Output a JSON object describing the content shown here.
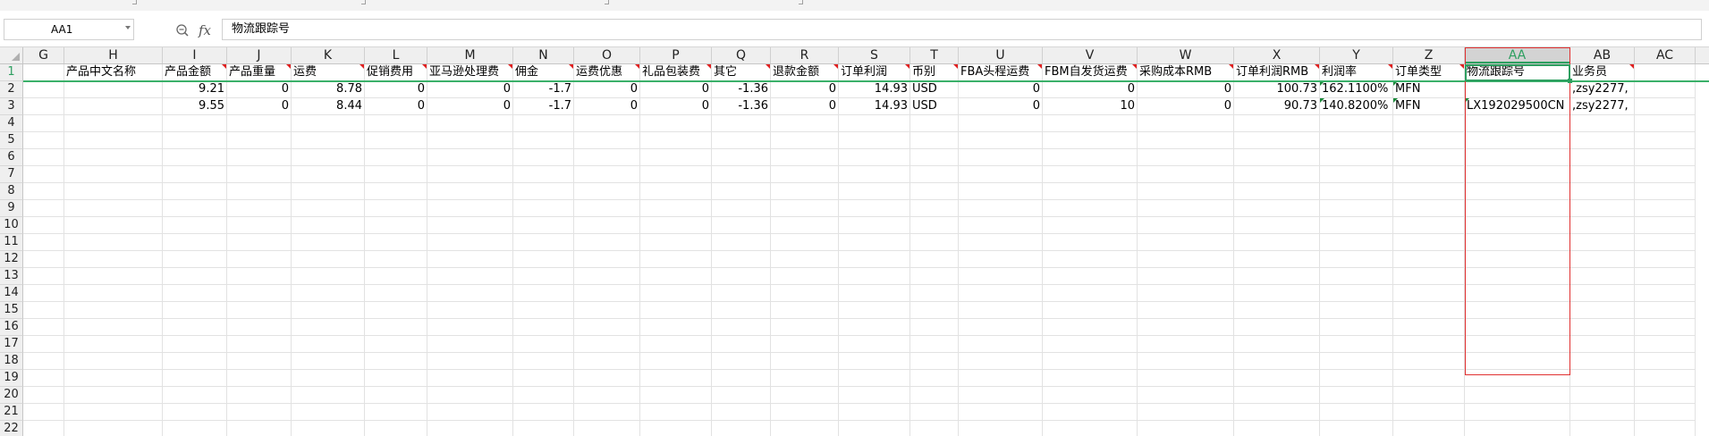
{
  "formula_bar": {
    "name_box": "AA1",
    "zoom_icon": "zoom-icon",
    "fx_label": "fx",
    "formula_value": "物流跟踪号"
  },
  "columns": [
    "G",
    "H",
    "I",
    "J",
    "K",
    "L",
    "M",
    "N",
    "O",
    "P",
    "Q",
    "R",
    "S",
    "T",
    "U",
    "V",
    "W",
    "X",
    "Y",
    "Z",
    "AA",
    "AB",
    "AC"
  ],
  "selected_column": "AA",
  "rows": [
    "1",
    "2",
    "3",
    "4",
    "5",
    "6",
    "7",
    "8",
    "9",
    "10",
    "11",
    "12",
    "13",
    "14",
    "15",
    "16",
    "17",
    "18",
    "19",
    "20",
    "21",
    "22"
  ],
  "selected_row": "1",
  "header_row": [
    "",
    "产品中文名称",
    "产品金额",
    "产品重量",
    "运费",
    "促销费用",
    "亚马逊处理费",
    "佣金",
    "运费优惠",
    "礼品包装费",
    "其它",
    "退款金额",
    "订单利润",
    "币别",
    "FBA头程运费",
    "FBM自发货运费",
    "采购成本RMB",
    "订单利润RMB",
    "利润率",
    "订单类型",
    "物流跟踪号",
    "业务员",
    ""
  ],
  "data_rows": [
    [
      "",
      "",
      "9.21",
      "0",
      "8.78",
      "0",
      "0",
      "-1.7",
      "0",
      "0",
      "-1.36",
      "0",
      "14.93",
      "USD",
      "0",
      "0",
      "0",
      "100.73",
      "162.1100%",
      "MFN",
      "",
      ",zsy2277,",
      ""
    ],
    [
      "",
      "",
      "9.55",
      "0",
      "8.44",
      "0",
      "0",
      "-1.7",
      "0",
      "0",
      "-1.36",
      "0",
      "14.93",
      "USD",
      "0",
      "10",
      "0",
      "90.73",
      "140.8200%",
      "MFN",
      "LX192029500CN",
      ",zsy2277,",
      ""
    ]
  ],
  "comment_marker_color": "#e02020",
  "selection_color": "#2e9f60",
  "highlight_color": "#e03030"
}
